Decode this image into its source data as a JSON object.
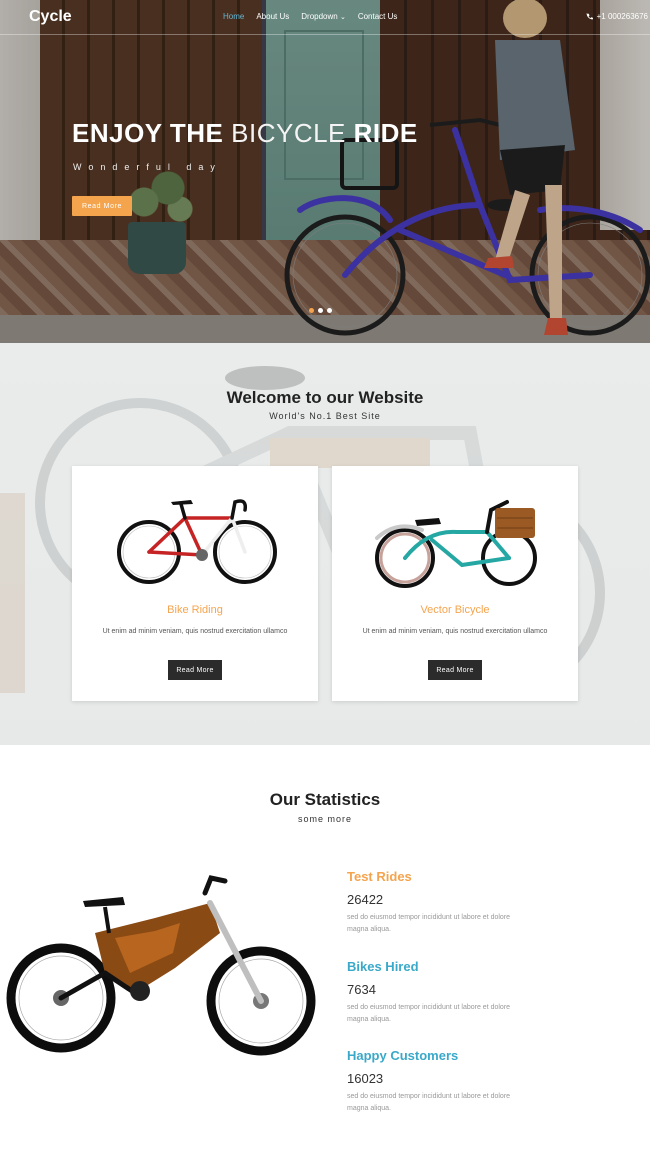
{
  "nav": {
    "brand": "Cycle",
    "links": [
      {
        "label": "Home",
        "active": true
      },
      {
        "label": "About Us",
        "active": false
      },
      {
        "label": "Dropdown",
        "active": false,
        "caret": "⌄"
      },
      {
        "label": "Contact Us",
        "active": false
      }
    ],
    "phone_icon": "phone-icon",
    "phone": "+1 000263676"
  },
  "hero": {
    "title_bold_1": "ENJOY THE",
    "title_light": "BICYCLE",
    "title_bold_2": "RIDE",
    "subtitle": "Wonderful day",
    "button": "Read More",
    "slides": 3,
    "active_slide": 0
  },
  "welcome": {
    "title": "Welcome to our Website",
    "subtitle": "World's No.1 Best Site",
    "cards": [
      {
        "title": "Bike Riding",
        "text": "Ut enim ad minim veniam, quis nostrud exercitation ullamco",
        "button": "Read More"
      },
      {
        "title": "Vector Bicycle",
        "text": "Ut enim ad minim veniam, quis nostrud exercitation ullamco",
        "button": "Read More"
      }
    ]
  },
  "stats": {
    "title": "Our Statistics",
    "subtitle": "some more",
    "items": [
      {
        "title": "Test Rides",
        "value": "26422",
        "text": "sed do eiusmod tempor incididunt ut labore et dolore magna aliqua.",
        "color": "#f5a44e"
      },
      {
        "title": "Bikes Hired",
        "value": "7634",
        "text": "sed do eiusmod tempor incididunt ut labore et dolore magna aliqua.",
        "color": "#3aa9c9"
      },
      {
        "title": "Happy Customers",
        "value": "16023",
        "text": "sed do eiusmod tempor incididunt ut labore et dolore magna aliqua.",
        "color": "#3aa9c9"
      }
    ]
  },
  "colors": {
    "accent_orange": "#f5a44e",
    "accent_blue": "#3aa9c9",
    "nav_active": "#62b6d6",
    "dark_button": "#2b2b2b"
  }
}
